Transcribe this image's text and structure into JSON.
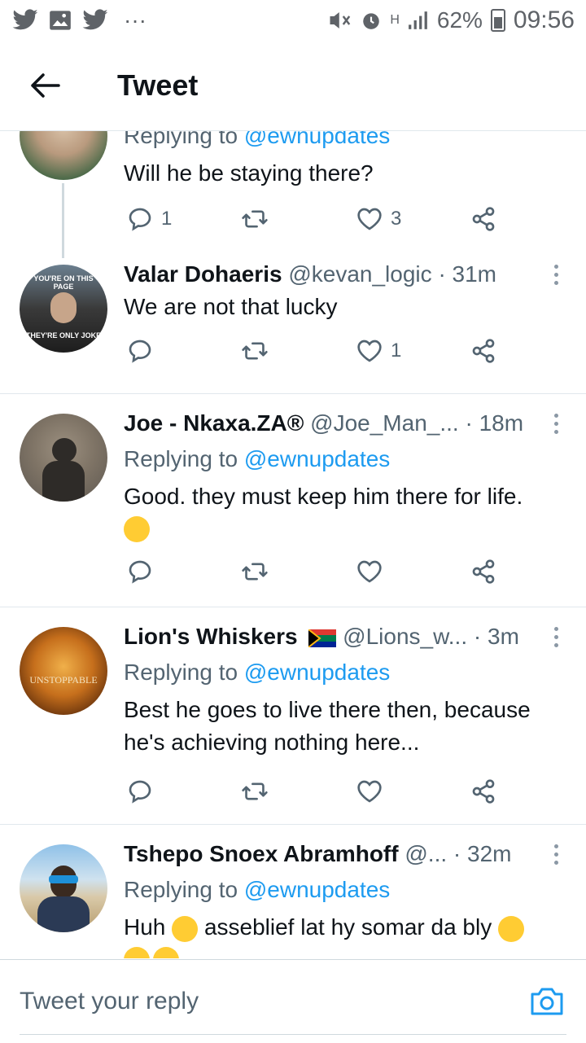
{
  "status_bar": {
    "battery": "62%",
    "time": "09:56",
    "dots": "···",
    "network": "H"
  },
  "header": {
    "title": "Tweet"
  },
  "tweets": [
    {
      "reply_to_prefix": "Replying to",
      "reply_to": "@ewnupdates",
      "text": "Will he be staying there?",
      "replies": "1",
      "likes": "3"
    },
    {
      "name": "Valar Dohaeris",
      "handle": "@kevan_logic",
      "time": "· 31m",
      "text": "We are not that lucky",
      "likes": "1",
      "avatar_text_top": "YOU'RE ON THIS PAGE",
      "avatar_text_bottom": "THEY'RE ONLY JOKE"
    },
    {
      "name": "Joe - Nkaxa.ZA®",
      "handle": "@Joe_Man_...",
      "time": "· 18m",
      "reply_to_prefix": "Replying to",
      "reply_to": "@ewnupdates",
      "text": "Good. they must keep him there for life."
    },
    {
      "name": "Lion's Whiskers",
      "handle": "@Lions_w...",
      "time": "· 3m",
      "reply_to_prefix": "Replying to",
      "reply_to": "@ewnupdates",
      "text_line1": "Best he goes to live there then, because",
      "text_line2": "he's achieving nothing here...",
      "avatar_text": "UNSTOPPABLE"
    },
    {
      "name": "Tshepo Snoex Abramhoff",
      "handle": "@...",
      "time": "· 32m",
      "reply_to_prefix": "Replying to",
      "reply_to": "@ewnupdates",
      "text_a": "Huh",
      "text_b": "asseblief lat hy somar da bly"
    }
  ],
  "reply_bar": {
    "placeholder": "Tweet your reply"
  },
  "colors": {
    "accent": "#1d9bf0",
    "muted": "#536471"
  }
}
